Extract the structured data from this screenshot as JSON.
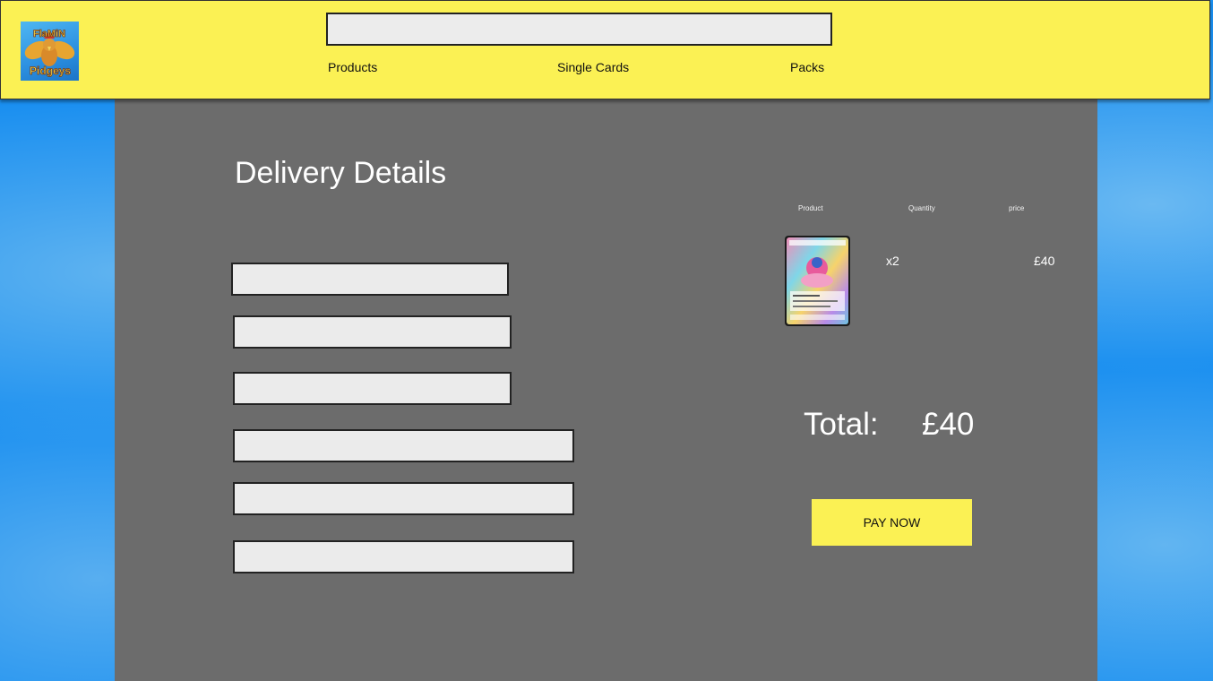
{
  "header": {
    "logo_text_line1": "FlaMiN",
    "logo_text_line2": "Pidgeys",
    "search": {
      "value": "",
      "placeholder": ""
    },
    "nav": {
      "products": "Products",
      "single_cards": "Single Cards",
      "packs": "Packs"
    }
  },
  "delivery": {
    "title": "Delivery Details",
    "fields": [
      {
        "value": "",
        "placeholder": ""
      },
      {
        "value": "",
        "placeholder": ""
      },
      {
        "value": "",
        "placeholder": ""
      },
      {
        "value": "",
        "placeholder": ""
      },
      {
        "value": "",
        "placeholder": ""
      },
      {
        "value": "",
        "placeholder": ""
      }
    ]
  },
  "cart": {
    "columns": {
      "product": "Product",
      "quantity": "Quantity",
      "price": "price"
    },
    "items": [
      {
        "product_icon": "pokemon-card-image",
        "quantity": "x2",
        "price": "£40"
      }
    ],
    "total_label": "Total:",
    "total_value": "£40",
    "pay_button": "PAY NOW"
  },
  "colors": {
    "header_bg": "#fbf154",
    "panel_bg": "#6c6c6c",
    "page_bg": "#1a8ff0",
    "input_bg": "#ebebeb",
    "button_bg": "#fbf154"
  }
}
